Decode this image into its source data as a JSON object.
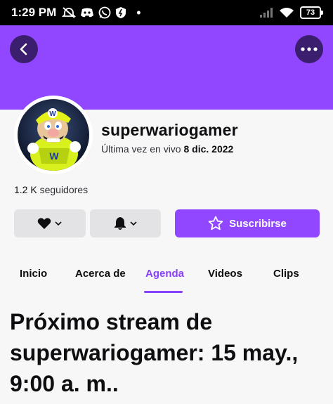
{
  "status_bar": {
    "time": "1:29 PM",
    "dot": "•",
    "battery": "73",
    "icons": [
      "mute-icon",
      "discord-icon",
      "whatsapp-icon",
      "shield-icon",
      "signal-icon",
      "wifi-icon",
      "battery-icon"
    ]
  },
  "banner": {
    "color": "#9146ff"
  },
  "channel": {
    "name": "superwariogamer",
    "last_live_prefix": "Última vez en vivo ",
    "last_live_date": "8 dic. 2022",
    "followers_count": "1.2 K",
    "followers_label": " seguidores"
  },
  "actions": {
    "subscribe_label": "Suscribirse"
  },
  "tabs": [
    {
      "label": "Inicio",
      "active": false
    },
    {
      "label": "Acerca de",
      "active": false
    },
    {
      "label": "Agenda",
      "active": true
    },
    {
      "label": "Videos",
      "active": false
    },
    {
      "label": "Clips",
      "active": false
    }
  ],
  "schedule": {
    "headline": "Próximo stream de superwariogamer: 15 may., 9:00 a. m.."
  },
  "colors": {
    "accent": "#9146ff",
    "tab_active": "#8a3ffc"
  }
}
